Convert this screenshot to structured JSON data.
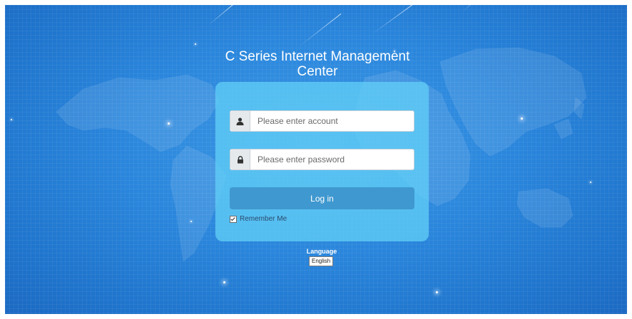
{
  "page": {
    "title": "C Series Internet Management Center"
  },
  "login": {
    "account_placeholder": "Please enter account",
    "account_icon": "user-icon",
    "password_placeholder": "Please enter password",
    "password_icon": "lock-icon",
    "submit_label": "Log in",
    "remember_label": "Remember Me",
    "remember_checked": true
  },
  "language": {
    "label": "Language",
    "selected": "English"
  },
  "colors": {
    "background": "#2a86dc",
    "panel": "#60cdf6",
    "button": "#3f98cf"
  }
}
